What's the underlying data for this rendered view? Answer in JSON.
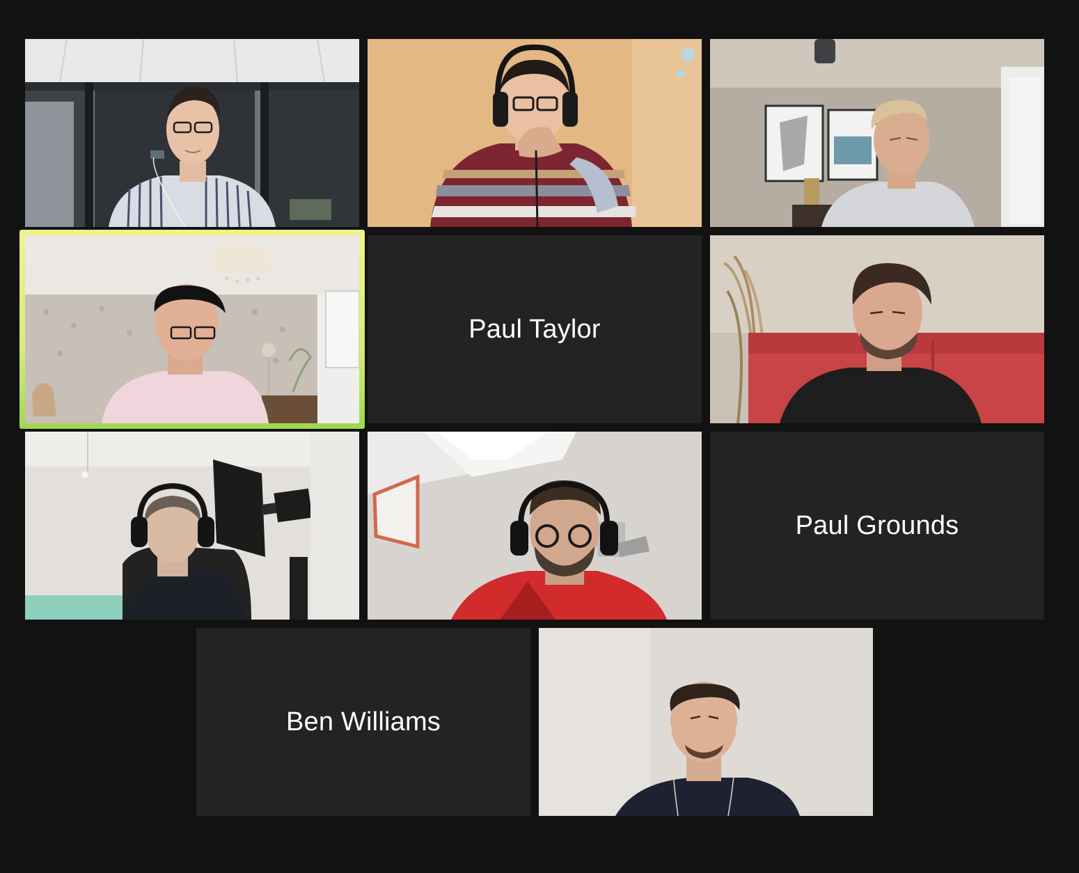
{
  "meeting": {
    "active_speaker_color": "#e8f07c",
    "background_color": "#121212",
    "tile_color": "#232323"
  },
  "participants": [
    {
      "video": true,
      "scene": "office-glass-striped-shirt"
    },
    {
      "video": true,
      "scene": "headset-striped-sweater"
    },
    {
      "video": true,
      "scene": "blond-grey-tshirt"
    },
    {
      "video": true,
      "active_speaker": true,
      "scene": "pink-shirt-glasses"
    },
    {
      "video": false,
      "name": "Paul Taylor"
    },
    {
      "video": true,
      "scene": "red-sofa"
    },
    {
      "video": true,
      "scene": "headphones-black-hoodie"
    },
    {
      "video": true,
      "scene": "headset-red-shirt"
    },
    {
      "video": false,
      "name": "Paul Grounds"
    },
    {
      "video": false,
      "name": "Ben Williams"
    },
    {
      "video": true,
      "scene": "earphones-navy-tshirt"
    }
  ]
}
